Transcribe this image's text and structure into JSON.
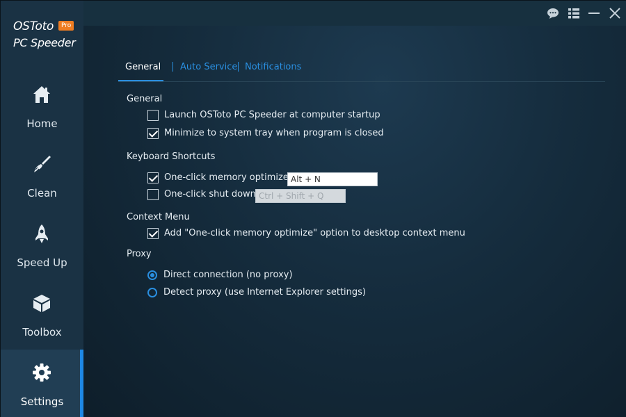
{
  "app": {
    "name": "OSToto",
    "badge": "Pro",
    "subtitle": "PC Speeder"
  },
  "sidebar": {
    "items": [
      {
        "label": "Home",
        "icon": "home-icon"
      },
      {
        "label": "Clean",
        "icon": "brush-icon"
      },
      {
        "label": "Speed Up",
        "icon": "rocket-icon"
      },
      {
        "label": "Toolbox",
        "icon": "box-icon"
      },
      {
        "label": "Settings",
        "icon": "gear-icon",
        "active": true
      }
    ]
  },
  "titlebar": {
    "buttons": [
      "feedback-icon",
      "menu-icon",
      "minimize-icon",
      "close-icon"
    ]
  },
  "tabs": [
    {
      "label": "General",
      "active": true
    },
    {
      "label": "Auto Service"
    },
    {
      "label": "Notifications"
    }
  ],
  "sections": {
    "general": {
      "title": "General",
      "startup_label": "Launch OSToto PC Speeder at computer startup",
      "startup_checked": false,
      "tray_label": "Minimize to system tray when program is closed",
      "tray_checked": true
    },
    "shortcuts": {
      "title": "Keyboard Shortcuts",
      "memory_label": "One-click memory optimize :",
      "memory_checked": true,
      "memory_value": "Alt + N",
      "shutdown_label": "One-click shut down:",
      "shutdown_checked": false,
      "shutdown_value": "Ctrl + Shift + Q"
    },
    "context": {
      "title": "Context Menu",
      "option_label": "Add \"One-click memory optimize\" option to desktop context menu",
      "option_checked": true
    },
    "proxy": {
      "title": "Proxy",
      "direct_label": "Direct connection (no proxy)",
      "detect_label": "Detect proxy (use Internet Explorer settings)",
      "selected": "direct"
    }
  },
  "colors": {
    "accent": "#2a8fe0",
    "badge": "#ef7d22",
    "sidebar": "#1a3244"
  }
}
